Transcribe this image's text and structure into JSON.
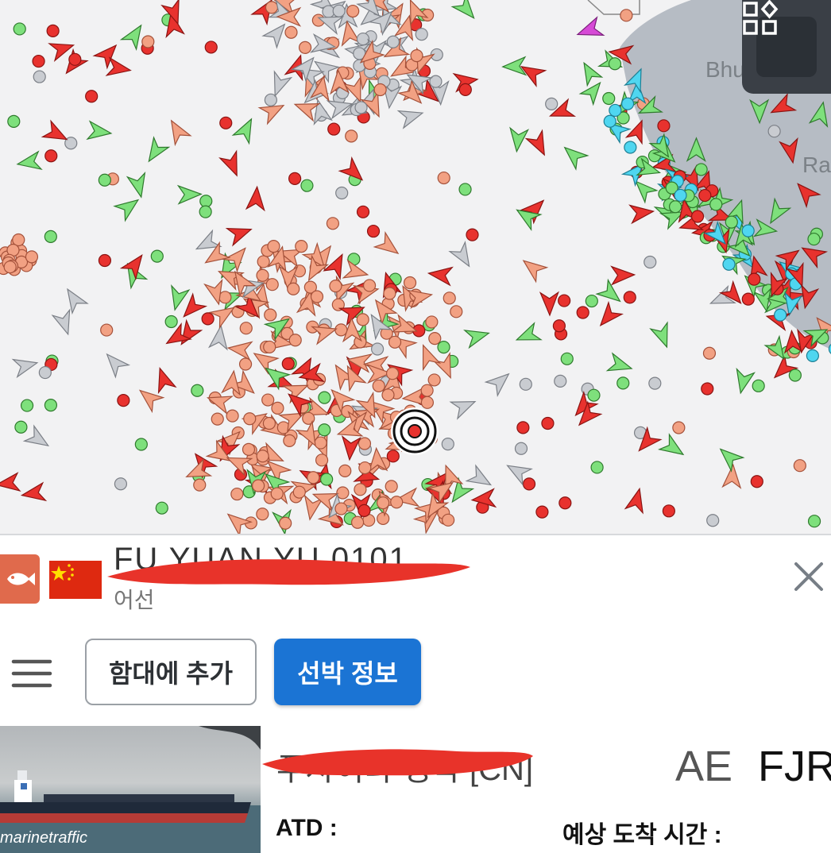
{
  "map": {
    "labels": [
      "Bhu",
      "Ra"
    ],
    "colors": {
      "sea": "#f2f2f3",
      "land": "#b6bcc4",
      "cargo": "#7ee07c",
      "tanker": "#e8322e",
      "fishing": "#f2a183",
      "passenger": "#4fd6f0",
      "other": "#c9ccd1",
      "special": "#d64ad6"
    },
    "layers_button_icon": "layers-grid-icon"
  },
  "panel": {
    "ship_type_icon": "fish-icon",
    "flag": "china-flag-icon",
    "ship_name": "FU YUAN YU 0101",
    "ship_type": "어선",
    "close_icon": "close-icon",
    "menu_icon": "hamburger-menu-icon",
    "add_to_fleet": "함대에 추가",
    "vessel_info": "선박 정보",
    "photo_watermark": "marinetraffic",
    "destination": "푸자이라 정박 [CN]",
    "dest_country": "AE",
    "dest_port": "FJR",
    "atd_label": "ATD :",
    "eta_label": "예상 도착 시간 :"
  }
}
